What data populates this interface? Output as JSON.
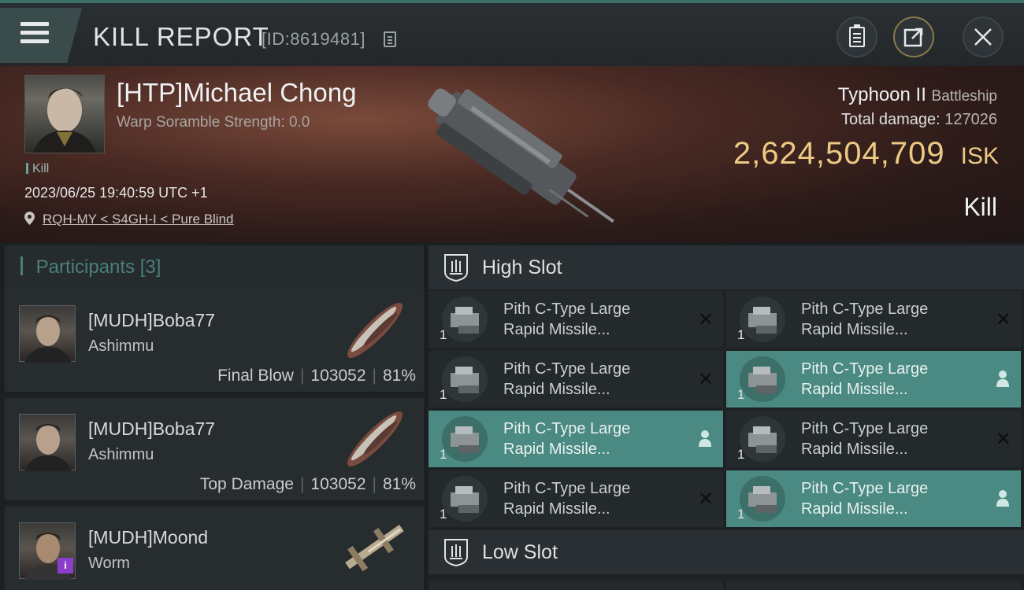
{
  "header": {
    "title": "KILL REPORT",
    "report_id": "[ID:8619481]"
  },
  "victim": {
    "name": "[HTP]Michael Chong",
    "warp_scramble": "Warp Soramble Strength: 0.0",
    "tag": "Kill",
    "datetime": "2023/06/25 19:40:59 UTC +1",
    "location": "RQH-MY < S4GH-I < Pure Blind",
    "ship_name": "Typhoon II",
    "ship_class": "Battleship",
    "total_damage_label": "Total damage:",
    "total_damage": "127026",
    "isk_value": "2,624,504,709",
    "isk_unit": "ISK",
    "result": "Kill"
  },
  "participants": {
    "title": "Participants",
    "count": "[3]",
    "rows": [
      {
        "name": "[MUDH]Boba77",
        "ship": "Ashimmu",
        "role": "Final Blow",
        "damage": "103052",
        "percent": "81%"
      },
      {
        "name": "[MUDH]Boba77",
        "ship": "Ashimmu",
        "role": "Top Damage",
        "damage": "103052",
        "percent": "81%"
      },
      {
        "name": "[MUDH]Moond",
        "ship": "Worm",
        "badge": "i"
      }
    ]
  },
  "high_slot": {
    "label": "High Slot",
    "modules": [
      {
        "line1": "Pith C-Type Large",
        "line2": "Rapid Missile...",
        "qty": "1",
        "state": "destroyed"
      },
      {
        "line1": "Pith C-Type Large",
        "line2": "Rapid Missile...",
        "qty": "1",
        "state": "destroyed"
      },
      {
        "line1": "Pith C-Type Large",
        "line2": "Rapid Missile...",
        "qty": "1",
        "state": "destroyed"
      },
      {
        "line1": "Pith C-Type Large",
        "line2": "Rapid Missile...",
        "qty": "1",
        "state": "dropped"
      },
      {
        "line1": "Pith C-Type Large",
        "line2": "Rapid Missile...",
        "qty": "1",
        "state": "dropped"
      },
      {
        "line1": "Pith C-Type Large",
        "line2": "Rapid Missile...",
        "qty": "1",
        "state": "destroyed"
      },
      {
        "line1": "Pith C-Type Large",
        "line2": "Rapid Missile...",
        "qty": "1",
        "state": "destroyed"
      },
      {
        "line1": "Pith C-Type Large",
        "line2": "Rapid Missile...",
        "qty": "1",
        "state": "dropped"
      }
    ]
  },
  "low_slot": {
    "label": "Low Slot"
  },
  "colors": {
    "accent_teal": "#4a8a82",
    "isk_gold": "#ecca83",
    "participants_title": "#4c7f7a"
  },
  "icons": [
    "menu-icon",
    "copy-icon",
    "clipboard-icon",
    "export-icon",
    "close-icon",
    "location-pin-icon",
    "slot-icon",
    "person-icon",
    "destroyed-x-icon"
  ]
}
